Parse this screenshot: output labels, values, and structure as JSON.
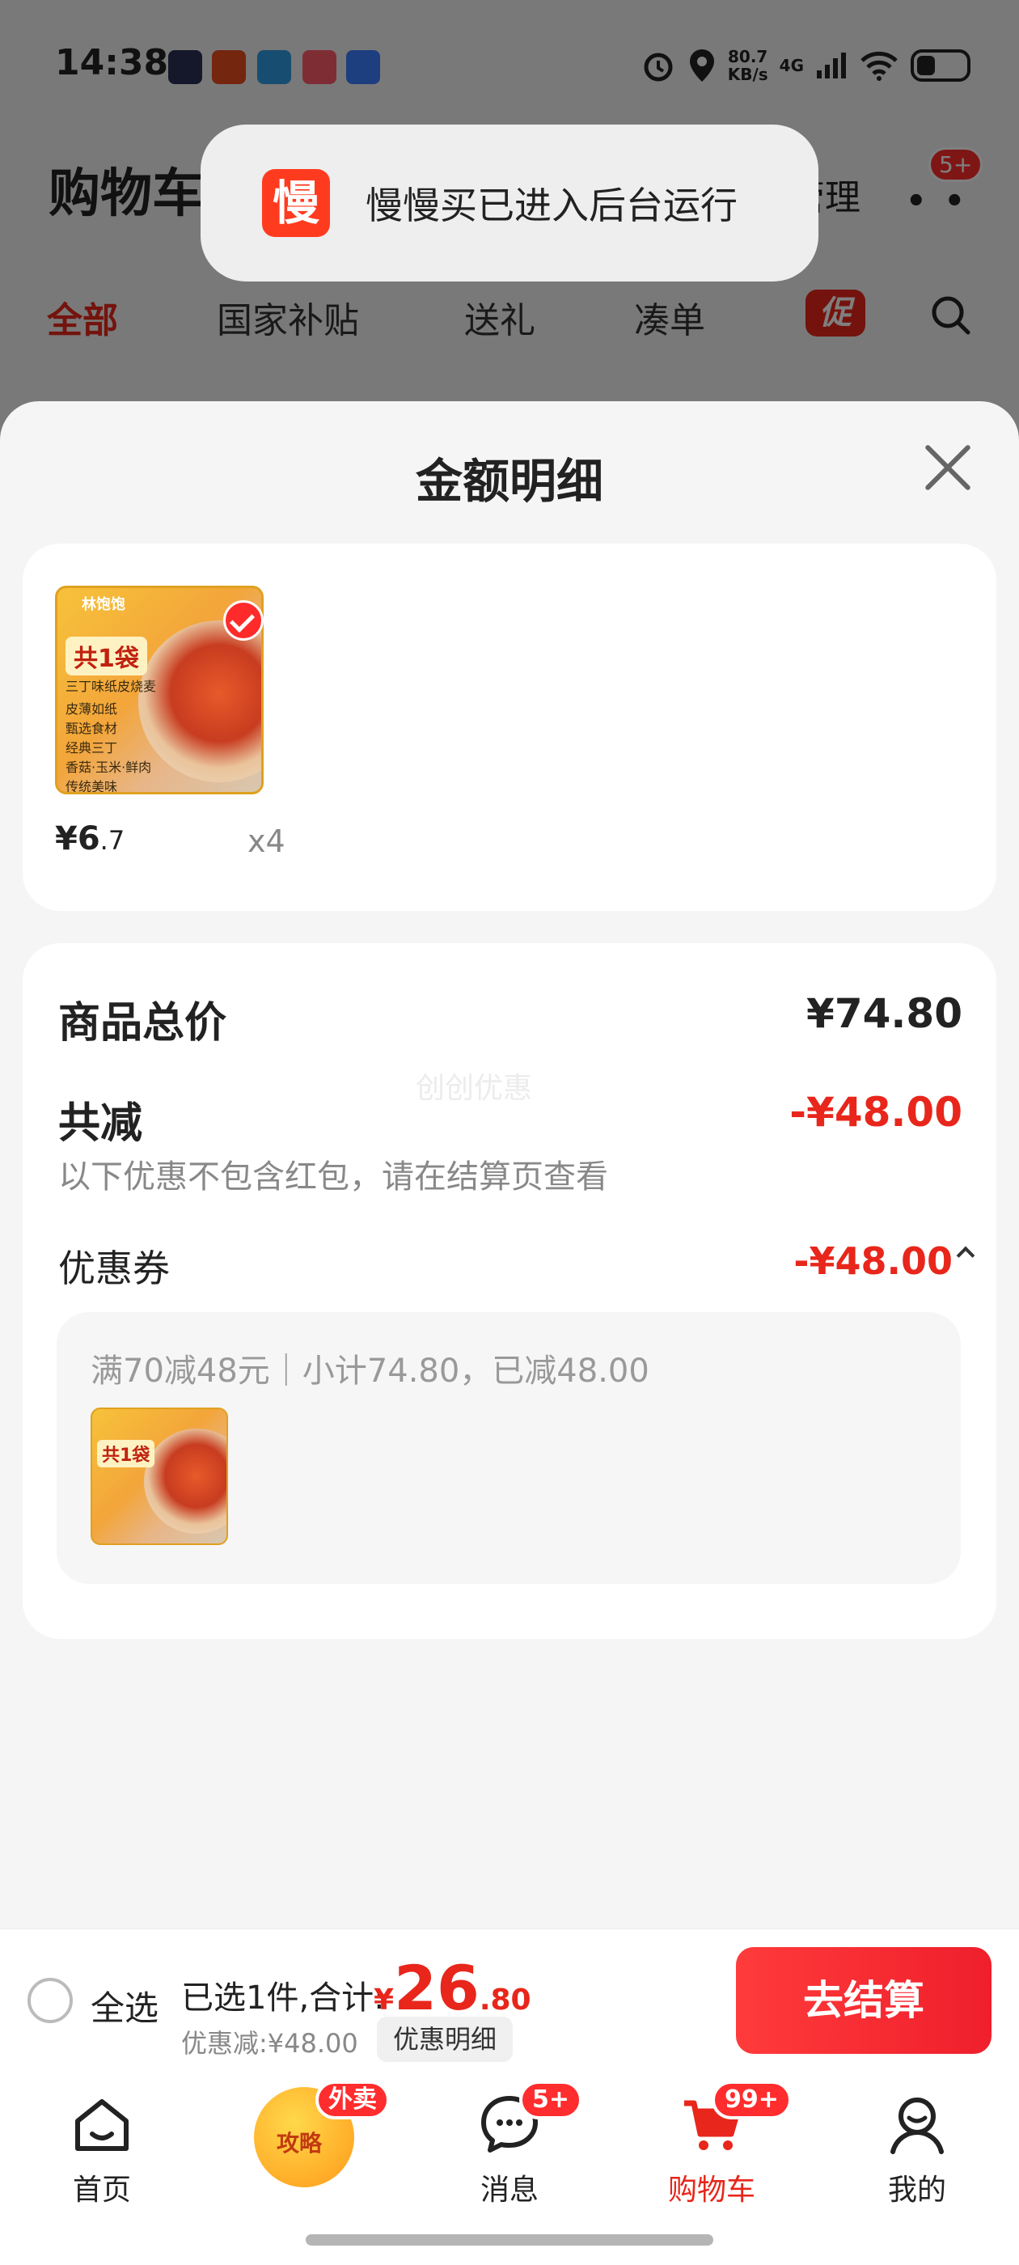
{
  "status_bar": {
    "time": "14:38",
    "speed_top": "80.7",
    "speed_bottom": "KB/s",
    "network": "4G"
  },
  "background_page": {
    "title": "购物车",
    "manage": "管理",
    "more_badge": "5+",
    "tabs": [
      "全部",
      "国家补贴",
      "送礼",
      "凑单"
    ],
    "promo_tag": "促"
  },
  "toast": {
    "logo_char": "慢",
    "text": "慢慢买已进入后台运行"
  },
  "sheet": {
    "title": "金额明细",
    "product": {
      "brand": "林饱饱",
      "badge": "共1袋",
      "lines": [
        "三丁味纸皮烧麦",
        "皮薄如纸",
        "甄选食材",
        "经典三丁",
        "香菇·玉米·鲜肉",
        "传统美味"
      ],
      "price_int": "¥6",
      "price_dec": ".7",
      "qty": "x4"
    },
    "summary": {
      "total_label": "商品总价",
      "total_value": "¥74.80",
      "reduce_label": "共减",
      "reduce_value": "-¥48.00",
      "reduce_note": "以下优惠不包含红包，请在结算页查看",
      "watermark": "创创优惠",
      "coupon_label": "优惠券",
      "coupon_value": "-¥48.00",
      "coupon_desc": "满70减48元｜小计74.80，已减48.00"
    }
  },
  "checkout": {
    "select_all": "全选",
    "selected": "已选1件,合计:",
    "total_cur": "¥",
    "total_int": "26",
    "total_dec": ".80",
    "discount": "优惠减:¥48.00",
    "discount_detail_btn": "优惠明细",
    "checkout_btn": "去结算"
  },
  "tabbar": {
    "home": "首页",
    "guide": "攻略",
    "guide_badge": "外卖",
    "messages": "消息",
    "messages_badge": "5+",
    "cart": "购物车",
    "cart_badge": "99+",
    "mine": "我的"
  },
  "colors": {
    "accent": "#e8261b",
    "checkout_btn": "#ef1f2c"
  }
}
